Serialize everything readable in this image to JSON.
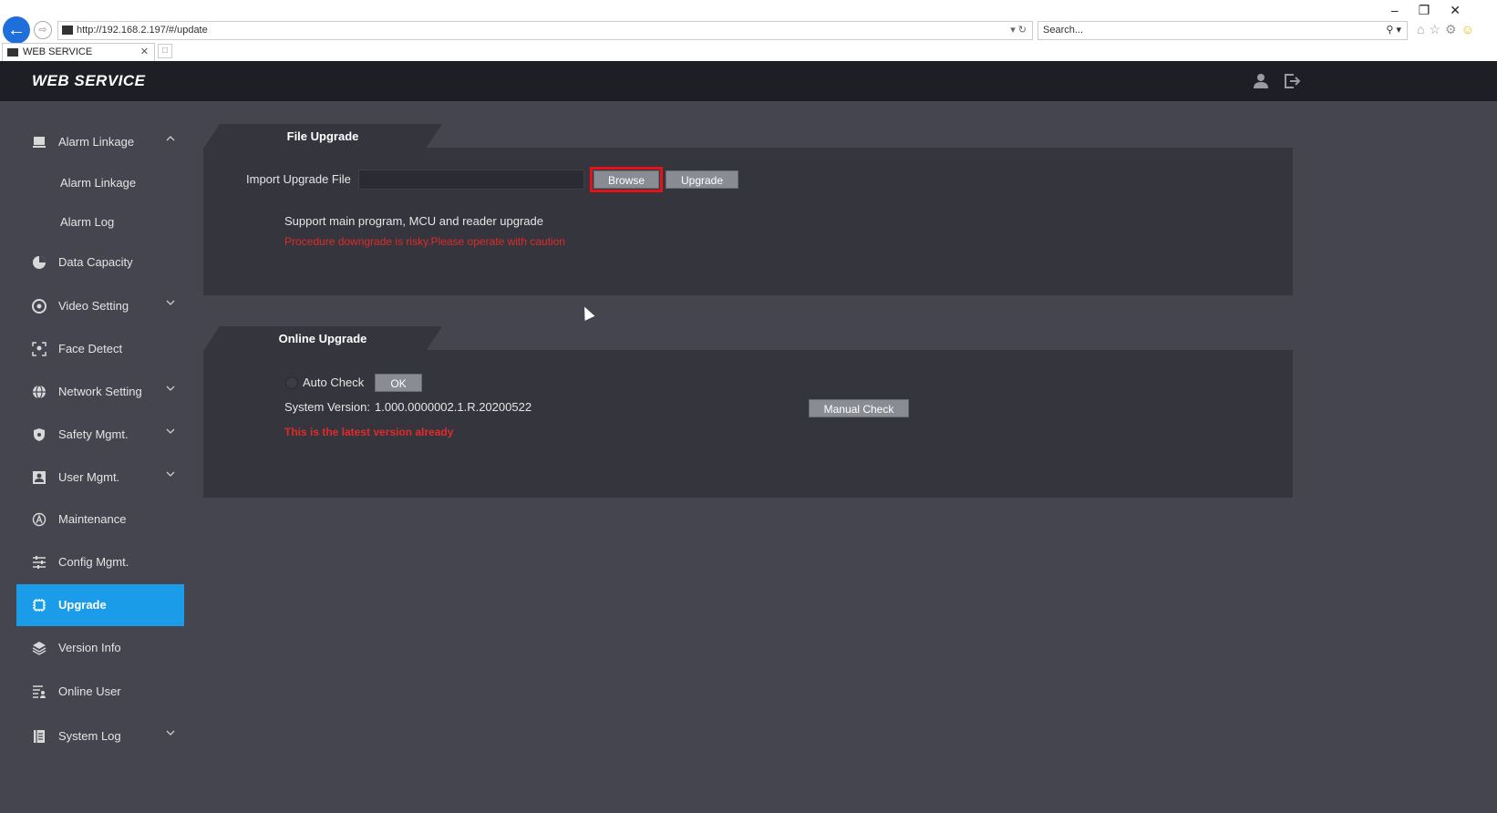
{
  "browser": {
    "url": "http://192.168.2.197/#/update",
    "search_placeholder": "Search...",
    "tab_title": "WEB SERVICE"
  },
  "app": {
    "title": "WEB SERVICE"
  },
  "sidebar": {
    "items": [
      {
        "label": "Alarm Linkage",
        "icon": "alarm-icon",
        "expand": "up"
      },
      {
        "label": "Alarm Linkage",
        "sub": true
      },
      {
        "label": "Alarm Log",
        "sub": true
      },
      {
        "label": "Data Capacity",
        "icon": "pie-chart-icon"
      },
      {
        "label": "Video Setting",
        "icon": "video-icon",
        "expand": "down"
      },
      {
        "label": "Face Detect",
        "icon": "face-detect-icon"
      },
      {
        "label": "Network Setting",
        "icon": "globe-icon",
        "expand": "down"
      },
      {
        "label": "Safety Mgmt.",
        "icon": "shield-icon",
        "expand": "down"
      },
      {
        "label": "User Mgmt.",
        "icon": "user-card-icon",
        "expand": "down"
      },
      {
        "label": "Maintenance",
        "icon": "maintenance-icon"
      },
      {
        "label": "Config Mgmt.",
        "icon": "sliders-icon"
      },
      {
        "label": "Upgrade",
        "icon": "chip-icon",
        "active": true
      },
      {
        "label": "Version Info",
        "icon": "layers-icon"
      },
      {
        "label": "Online User",
        "icon": "online-user-icon"
      },
      {
        "label": "System Log",
        "icon": "log-icon",
        "expand": "down"
      }
    ]
  },
  "file_upgrade": {
    "title": "File Upgrade",
    "import_label": "Import Upgrade File",
    "import_value": "",
    "browse_label": "Browse",
    "upgrade_label": "Upgrade",
    "support_text": "Support main program, MCU and reader upgrade",
    "warning_text": "Procedure downgrade is risky.Please operate with caution"
  },
  "online_upgrade": {
    "title": "Online Upgrade",
    "auto_check_label": "Auto Check",
    "ok_label": "OK",
    "version_label": "System Version:",
    "version_value": "1.000.0000002.1.R.20200522",
    "manual_check_label": "Manual Check",
    "status_text": "This is the latest version already"
  },
  "colors": {
    "accent": "#1a9ce8",
    "warning": "#e12a2a",
    "highlight": "#e3121b"
  }
}
